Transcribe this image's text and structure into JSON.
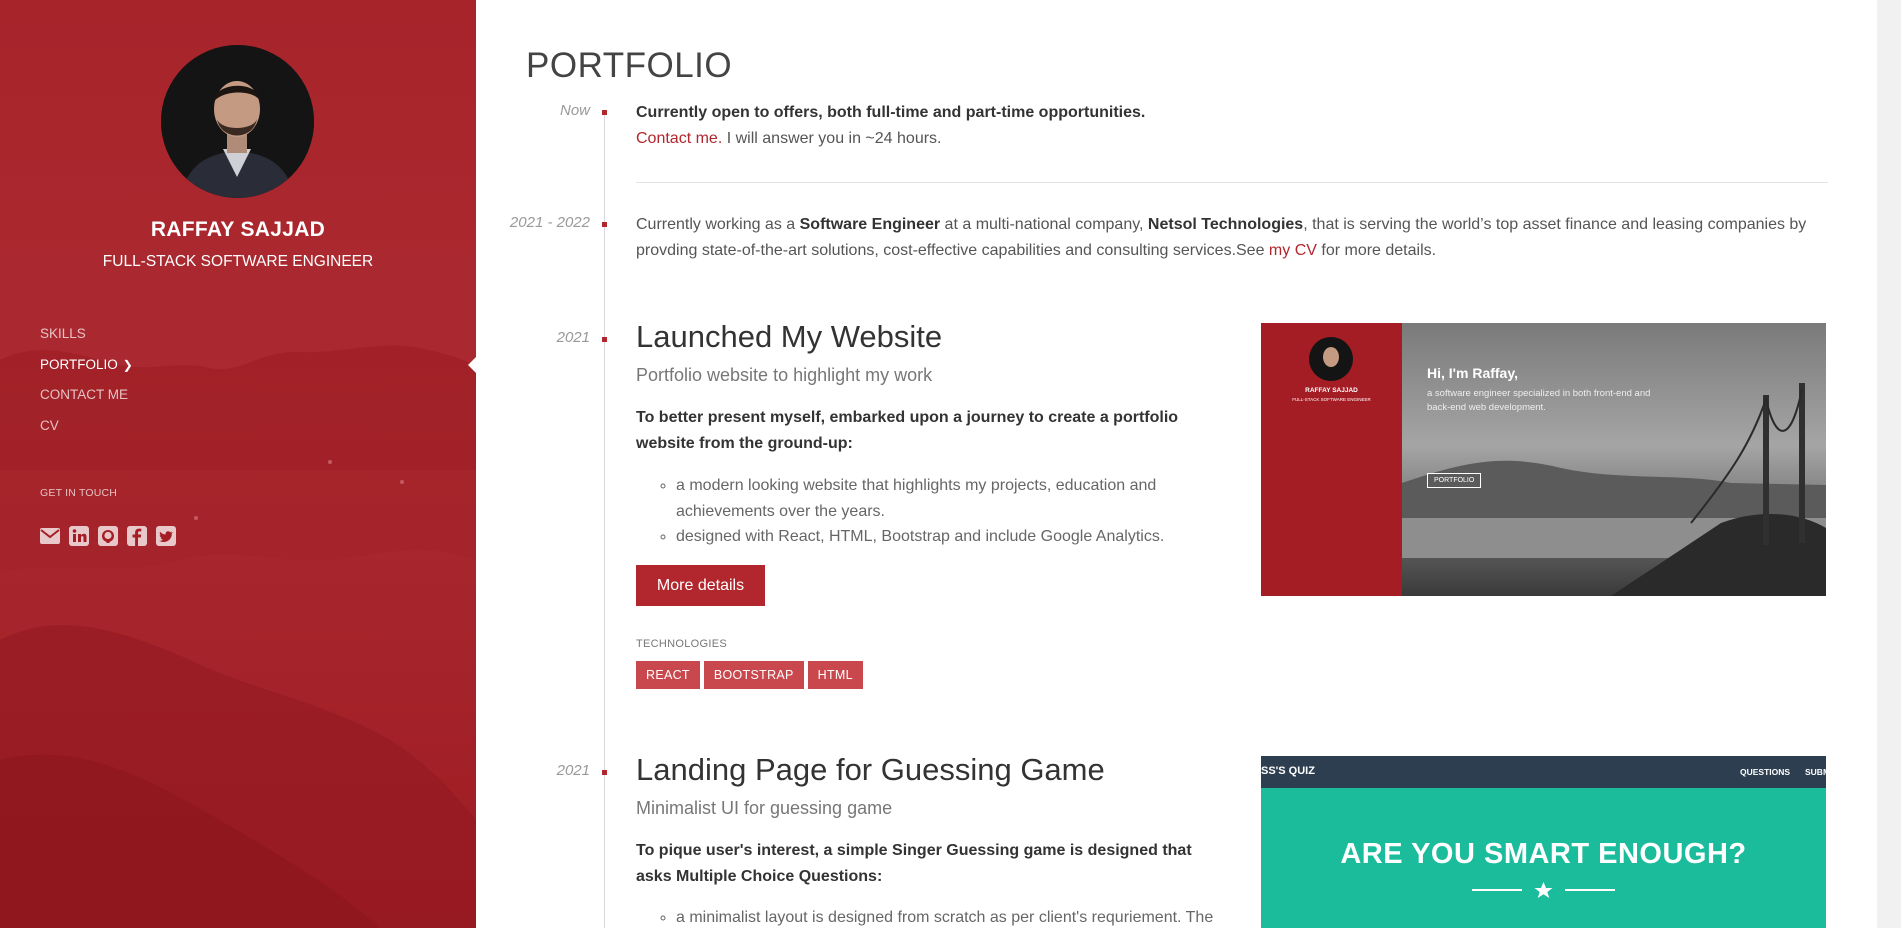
{
  "sidebar": {
    "name": "RAFFAY SAJJAD",
    "title": "FULL-STACK SOFTWARE ENGINEER",
    "nav": [
      {
        "label": "SKILLS"
      },
      {
        "label": "PORTFOLIO",
        "active": true
      },
      {
        "label": "CONTACT ME"
      },
      {
        "label": "CV"
      }
    ],
    "get_in_touch": "GET IN TOUCH",
    "social_icons": [
      "envelope-icon",
      "linkedin-icon",
      "github-icon",
      "facebook-icon",
      "twitter-icon"
    ]
  },
  "main": {
    "title": "PORTFOLIO",
    "now": {
      "date": "Now",
      "headline": "Currently open to offers, both full-time and part-time opportunities.",
      "contact_link": "Contact me.",
      "reply_text": " I will answer you in ~24 hours."
    },
    "job": {
      "date": "2021 - 2022",
      "t1": "Currently working as a ",
      "role": "Software Engineer",
      "t2": " at a multi-national company, ",
      "company": "Netsol Technologies",
      "t3": ", that is serving the world’s top asset finance and leasing companies by",
      "t4": "provding state-of-the-art solutions, cost-effective capabilities and consulting services.See ",
      "cv_link": "my CV",
      "t5": " for more details."
    },
    "projects": [
      {
        "date": "2021",
        "title": "Launched My Website",
        "subtitle": "Portfolio website to highlight my work",
        "intro": "To better present myself, embarked upon a journey to create a portfolio website from the ground-up:",
        "bullets": [
          "a modern looking website that highlights my projects, education and achievements over the years.",
          "designed with React, HTML, Bootstrap and include Google Analytics."
        ],
        "button": "More details",
        "tech_label": "TECHNOLOGIES",
        "technologies": [
          "REACT",
          "BOOTSTRAP",
          "HTML"
        ],
        "thumbnail": {
          "greeting": "Hi, I'm Raffay,",
          "desc": "a software engineer specialized in both front-end and back-end web development.",
          "button": "PORTFOLIO",
          "name": "RAFFAY SAJJAD",
          "role": "FULL-STACK SOFTWARE ENGINEER"
        }
      },
      {
        "date": "2021",
        "title": "Landing Page for Guessing Game",
        "subtitle": "Minimalist UI for guessing game",
        "intro": "To pique user's interest, a simple Singer Guessing game is designed that asks Multiple Choice Questions:",
        "bullets": [
          "a minimalist layout is designed from scratch as per client's requriement. The"
        ],
        "thumbnail": {
          "brand": "SS'S QUIZ",
          "nav1": "QUESTIONS",
          "nav2": "SUBM",
          "headline": "ARE YOU SMART ENOUGH?"
        }
      }
    ]
  },
  "colors": {
    "accent": "#b1272d",
    "sidebar": "#a51d24",
    "tag": "#c9484d",
    "quiz_teal": "#1abc9c",
    "quiz_nav": "#2c3e50"
  }
}
